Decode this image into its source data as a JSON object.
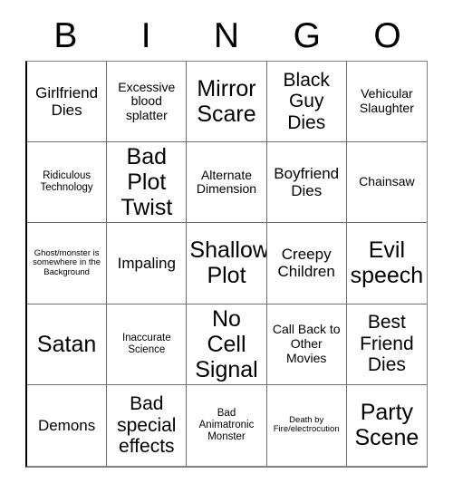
{
  "card": {
    "title_letters": [
      "B",
      "I",
      "N",
      "G",
      "O"
    ],
    "rows": [
      [
        {
          "text": "Girlfriend Dies",
          "size": "fs-md"
        },
        {
          "text": "Excessive blood splatter",
          "size": "fs-sm"
        },
        {
          "text": "Mirror Scare",
          "size": "fs-xl"
        },
        {
          "text": "Black Guy Dies",
          "size": "fs-lg"
        },
        {
          "text": "Vehicular Slaughter",
          "size": "fs-sm"
        }
      ],
      [
        {
          "text": "Ridiculous Technology",
          "size": "fs-xs"
        },
        {
          "text": "Bad Plot Twist",
          "size": "fs-xl"
        },
        {
          "text": "Alternate Dimension",
          "size": "fs-sm"
        },
        {
          "text": "Boyfriend Dies",
          "size": "fs-md"
        },
        {
          "text": "Chainsaw",
          "size": "fs-sm"
        }
      ],
      [
        {
          "text": "Ghost/monster is somewhere in the Background",
          "size": "fs-xxs"
        },
        {
          "text": "Impaling",
          "size": "fs-md"
        },
        {
          "text": "Shallow Plot",
          "size": "fs-xl"
        },
        {
          "text": "Creepy Children",
          "size": "fs-md"
        },
        {
          "text": "Evil speech",
          "size": "fs-xl"
        }
      ],
      [
        {
          "text": "Satan",
          "size": "fs-xl"
        },
        {
          "text": "Inaccurate Science",
          "size": "fs-xs"
        },
        {
          "text": "No Cell Signal",
          "size": "fs-xl"
        },
        {
          "text": "Call Back to Other Movies",
          "size": "fs-sm"
        },
        {
          "text": "Best Friend Dies",
          "size": "fs-lg"
        }
      ],
      [
        {
          "text": "Demons",
          "size": "fs-md"
        },
        {
          "text": "Bad special effects",
          "size": "fs-lg"
        },
        {
          "text": "Bad Animatronic Monster",
          "size": "fs-xs"
        },
        {
          "text": "Death by Fire/electrocution",
          "size": "fs-xxs"
        },
        {
          "text": "Party Scene",
          "size": "fs-xl"
        }
      ]
    ],
    "colors": {
      "background": "#ffffff",
      "text": "#000000",
      "grid_line": "#6e6e6e"
    }
  }
}
